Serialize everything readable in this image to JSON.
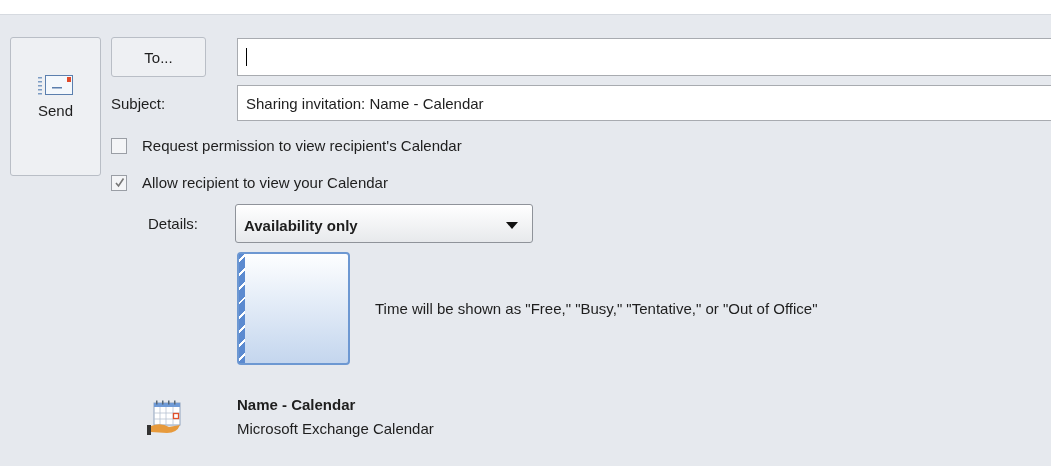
{
  "send_button": {
    "label": "Send"
  },
  "to_button": {
    "label": "To..."
  },
  "to_field": {
    "focused": true
  },
  "subject": {
    "label": "Subject:",
    "value": "Sharing invitation: Name - Calendar"
  },
  "checkboxes": [
    {
      "label": "Request permission to view recipient's Calendar",
      "checked": false
    },
    {
      "label": "Allow recipient to view your Calendar",
      "checked": true
    }
  ],
  "details": {
    "label": "Details:",
    "value": "Availability only"
  },
  "preview": {
    "description": "Time will be shown as \"Free,\" \"Busy,\" \"Tentative,\" or \"Out of Office\""
  },
  "calendar": {
    "name": "Name - Calendar",
    "type": "Microsoft Exchange Calendar"
  }
}
